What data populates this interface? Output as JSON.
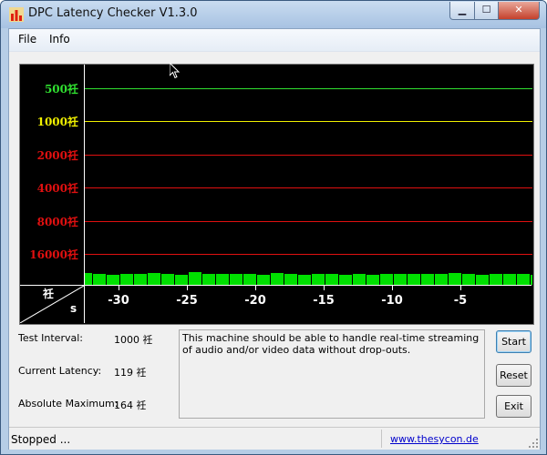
{
  "window": {
    "title": "DPC Latency Checker V1.3.0",
    "minimize_glyph": "▁",
    "maximize_glyph": "☐",
    "close_glyph": "✕"
  },
  "menu": [
    {
      "label": "File"
    },
    {
      "label": "Info"
    }
  ],
  "graph": {
    "y_labels": [
      {
        "text": "16000祍",
        "color": "#e01010"
      },
      {
        "text": "8000祍",
        "color": "#e01010"
      },
      {
        "text": "4000祍",
        "color": "#e01010"
      },
      {
        "text": "2000祍",
        "color": "#e01010"
      },
      {
        "text": "1000祍",
        "color": "#f0f000"
      },
      {
        "text": "500祍",
        "color": "#30e030"
      }
    ],
    "corner_top": "祍",
    "corner_bottom": "s",
    "x_labels": [
      "-30",
      "-25",
      "-20",
      "-15",
      "-10",
      "-5"
    ]
  },
  "chart_data": {
    "type": "bar",
    "ylabel": "祍",
    "xlabel": "s",
    "y_scale": "log2",
    "y_ticks": [
      500,
      1000,
      2000,
      4000,
      8000,
      16000
    ],
    "x_ticks": [
      -30,
      -25,
      -20,
      -15,
      -10,
      -5
    ],
    "bar_color": "#00e000",
    "values": [
      130,
      120,
      110,
      115,
      120,
      125,
      115,
      110,
      135,
      120,
      120,
      115,
      120,
      110,
      125,
      115,
      110,
      120,
      115,
      110,
      115,
      110,
      115,
      115,
      115,
      120,
      115,
      130,
      120,
      110,
      115,
      115,
      115,
      110,
      125,
      115,
      115,
      120,
      115,
      130,
      130,
      125,
      120,
      130,
      130,
      120,
      115,
      115,
      125,
      120,
      120,
      115,
      115,
      115,
      110,
      115,
      115,
      120,
      120,
      119
    ]
  },
  "info": {
    "test_interval_label": "Test Interval:",
    "test_interval_value": "1000 祍",
    "current_latency_label": "Current Latency:",
    "current_latency_value": "119 祍",
    "absolute_max_label": "Absolute Maximum:",
    "absolute_max_value": "164 祍",
    "message": "This machine should be able to handle real-time streaming of audio and/or video data without drop-outs."
  },
  "buttons": {
    "start": "Start",
    "reset": "Reset",
    "exit": "Exit"
  },
  "status": {
    "text": "Stopped ...",
    "link": "www.thesycon.de"
  }
}
